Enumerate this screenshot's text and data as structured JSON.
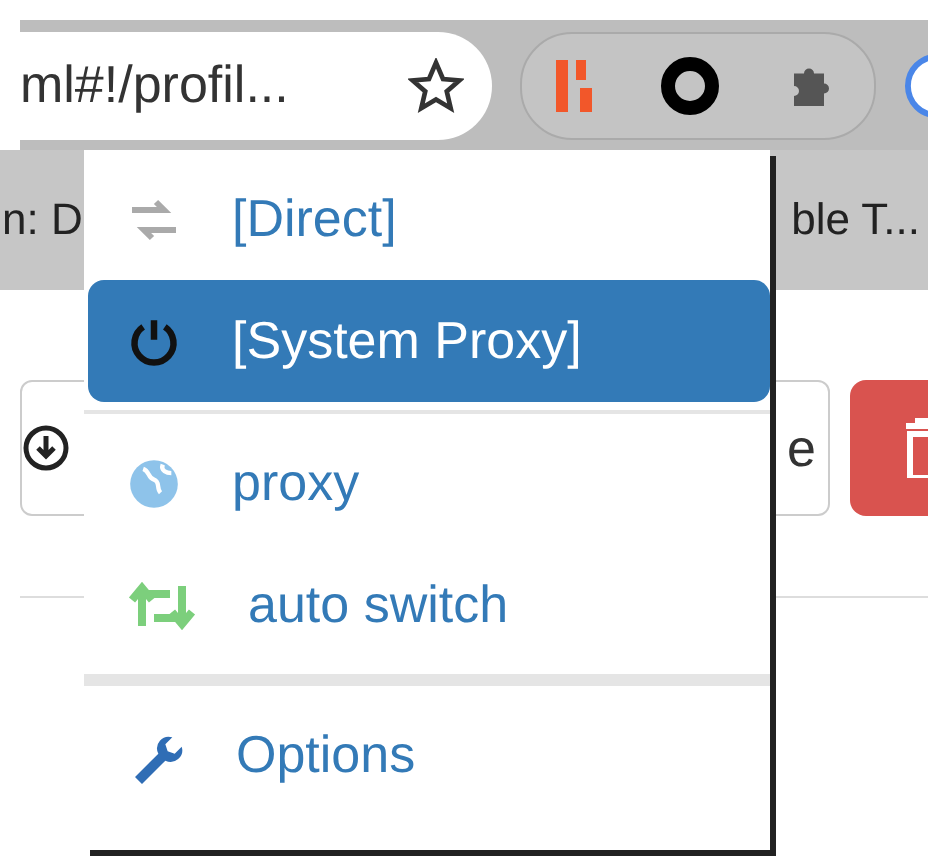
{
  "toolbar": {
    "address": "ml#!/profil...",
    "bookmarked": false
  },
  "bookmarks": [
    "n: D",
    "ble T..."
  ],
  "page": {
    "restore_button": "e"
  },
  "menu": {
    "items": [
      {
        "kind": "direct",
        "label": "[Direct]",
        "selected": false
      },
      {
        "kind": "system",
        "label": "[System Proxy]",
        "selected": true
      },
      {
        "kind": "divider"
      },
      {
        "kind": "proxy",
        "label": "proxy",
        "selected": false
      },
      {
        "kind": "switch",
        "label": "auto switch",
        "selected": false
      },
      {
        "kind": "section"
      },
      {
        "kind": "options",
        "label": "Options",
        "selected": false
      }
    ]
  }
}
